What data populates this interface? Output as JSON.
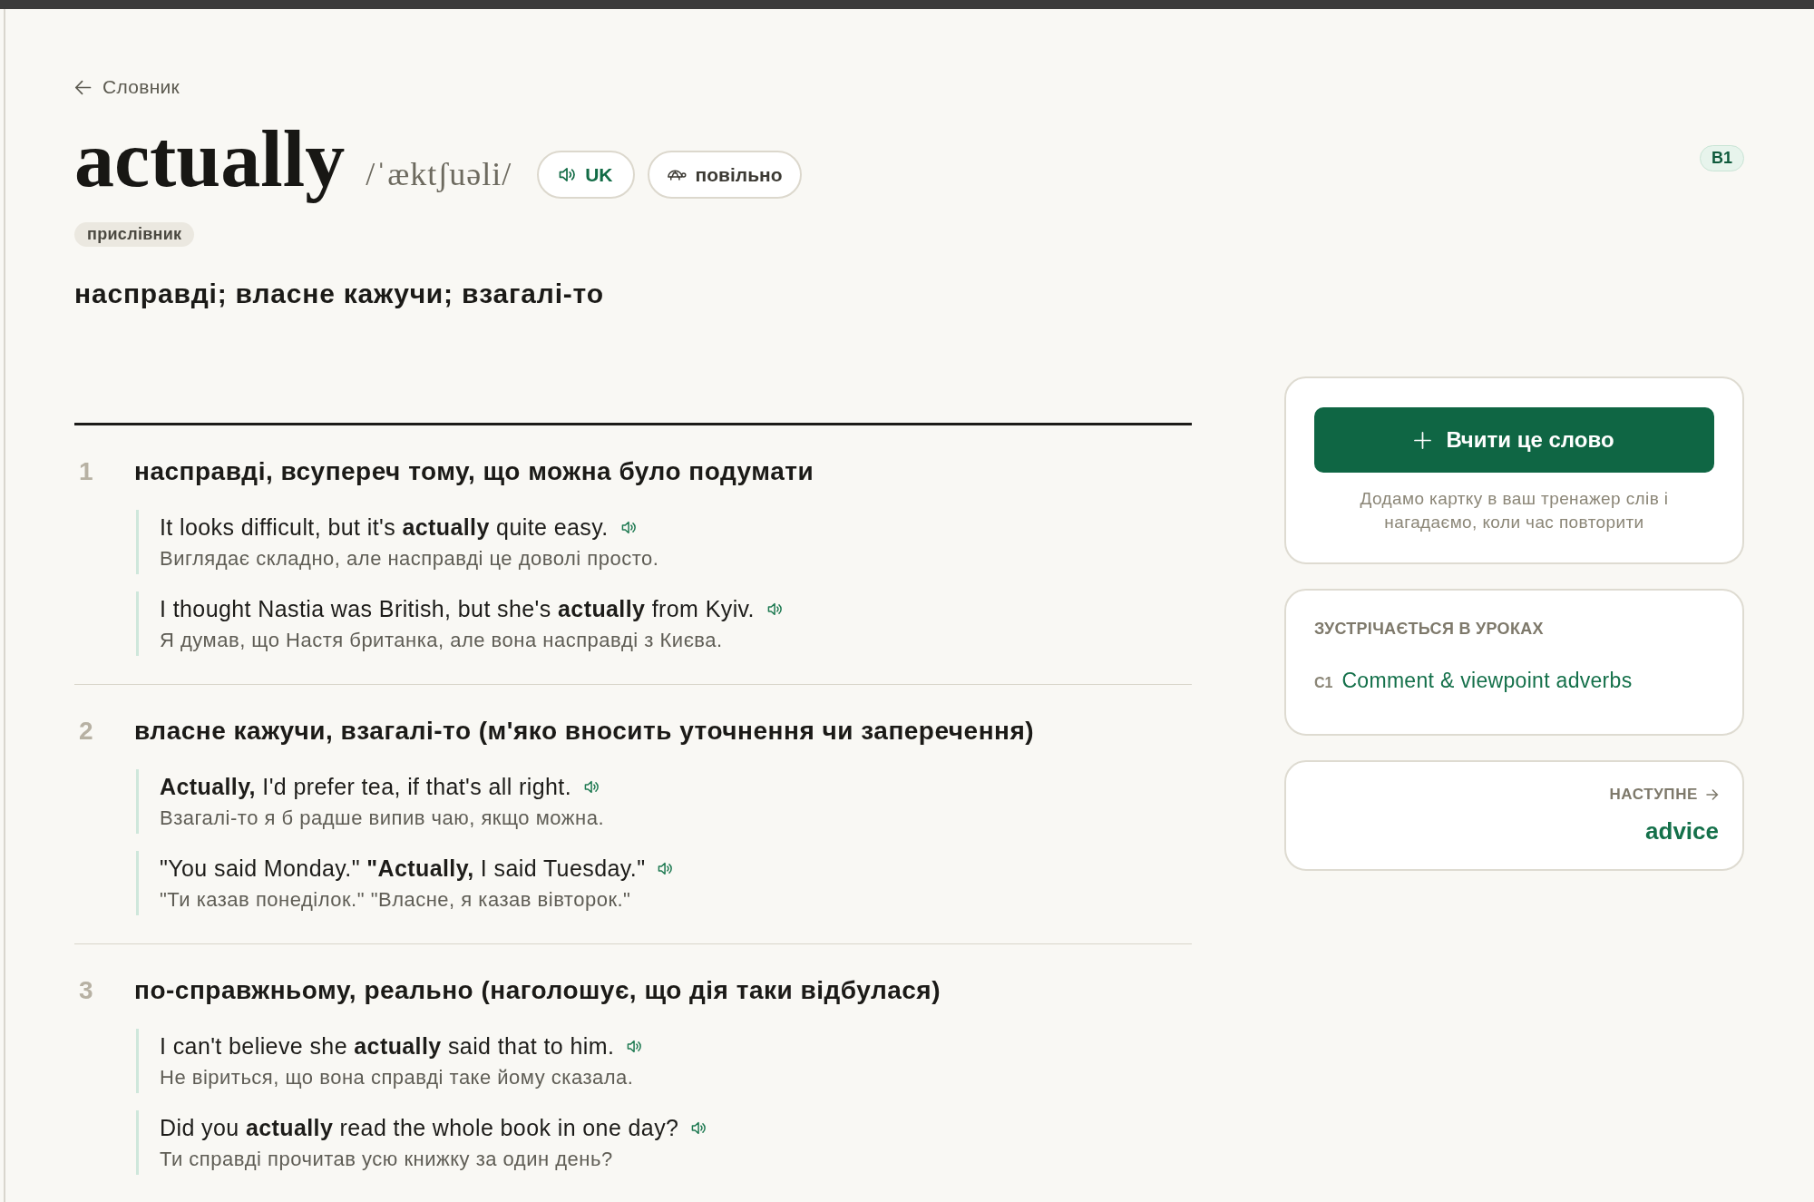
{
  "back_link": {
    "label": "Словник"
  },
  "entry": {
    "word": "actually",
    "transcription": "/ˈæktʃuəli/",
    "audio_buttons": [
      {
        "kind": "accent",
        "label": "UK"
      },
      {
        "kind": "slow",
        "label": "повільно"
      }
    ],
    "level_badge": "B1",
    "part_of_speech": "прислівник",
    "summary": "насправді; власне кажучи; взагалі-то"
  },
  "senses": [
    {
      "number": "1",
      "definition": "насправді, всупереч тому, що можна було подумати",
      "examples": [
        {
          "text": "It looks difficult, but it's **actually** quite easy.",
          "translation": "Виглядає складно, але насправді це доволі просто."
        },
        {
          "text": "I thought Nastia was British, but she's **actually** from Kyiv.",
          "translation": "Я думав, що Настя британка, але вона насправді з Києва."
        }
      ]
    },
    {
      "number": "2",
      "definition": "власне кажучи, взагалі-то (м'яко вносить уточнення чи заперечення)",
      "examples": [
        {
          "text": "**Actually,** I'd prefer tea, if that's all right.",
          "translation": "Взагалі-то я б радше випив чаю, якщо можна."
        },
        {
          "text": "\"You said Monday.\" **\"Actually,** I said Tuesday.\"",
          "translation": "\"Ти казав понеділок.\" \"Власне, я казав вівторок.\""
        }
      ]
    },
    {
      "number": "3",
      "definition": "по-справжньому, реально (наголошує, що дія таки відбулася)",
      "examples": [
        {
          "text": "I can't believe she **actually** said that to him.",
          "translation": "Не віриться, що вона справді таке йому сказала."
        },
        {
          "text": "Did you **actually** read the whole book in one day?",
          "translation": "Ти справді прочитав усю книжку за один день?"
        }
      ]
    }
  ],
  "sidebar": {
    "learn_card": {
      "button": "Вчити це слово",
      "note": "Додамо картку в ваш тренажер слів і нагадаємо, коли час повторити"
    },
    "lessons_card": {
      "heading": "ЗУСТРІЧАЄТЬСЯ В УРОКАХ",
      "lessons": [
        {
          "level": "C1",
          "title": "Comment & viewpoint adverbs"
        }
      ]
    },
    "next_card": {
      "label": "НАСТУПНЕ",
      "word": "advice"
    }
  }
}
